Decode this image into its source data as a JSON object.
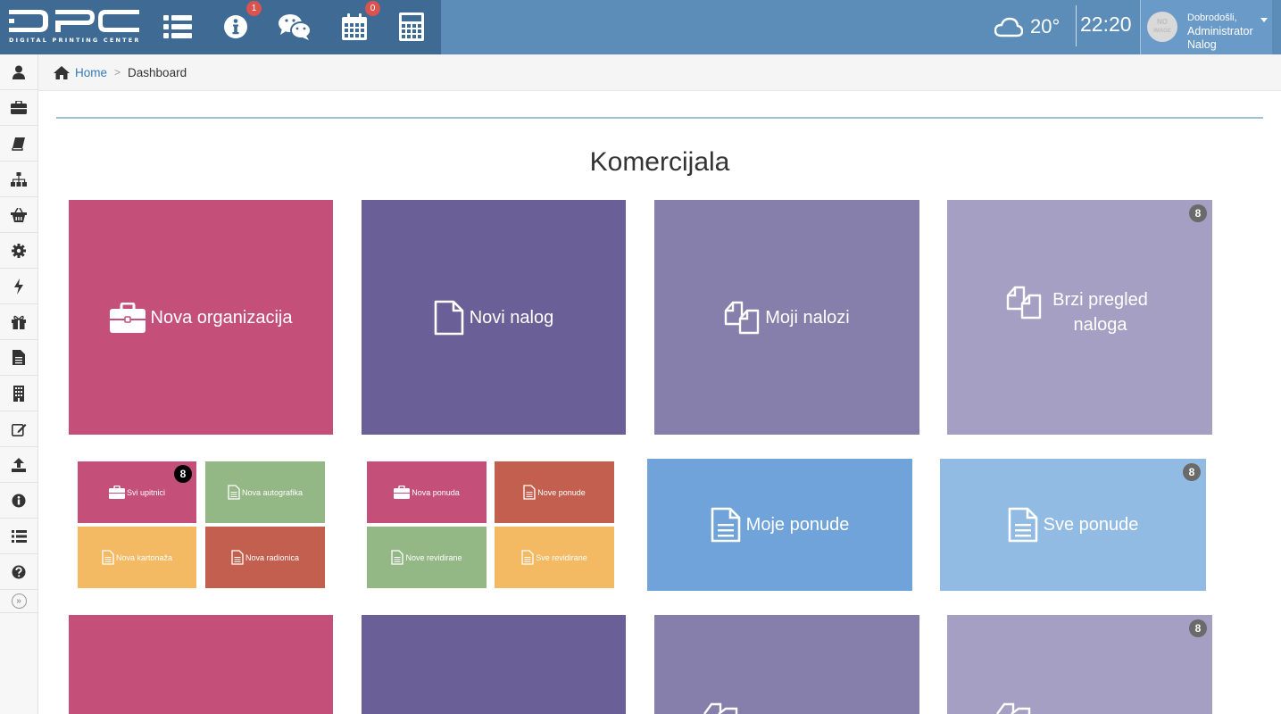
{
  "header": {
    "logo_text": "DPC",
    "logo_subtitle": "DIGITAL PRINTING CENTER",
    "icons": [
      {
        "name": "list-icon"
      },
      {
        "name": "info-icon",
        "badge": "1"
      },
      {
        "name": "chat-icon"
      },
      {
        "name": "calendar-icon",
        "badge": "0"
      },
      {
        "name": "calculator-icon"
      }
    ],
    "weather": {
      "icon": "cloud-icon",
      "temperature": "20°"
    },
    "clock": "22:20",
    "user": {
      "avatar_text": "NO IMAGE",
      "greeting": "Dobrodošli,",
      "name": "Administrator",
      "role": "Nalog"
    }
  },
  "sidebar": {
    "items": [
      {
        "icon": "user-icon"
      },
      {
        "icon": "briefcase-icon"
      },
      {
        "icon": "book-icon"
      },
      {
        "icon": "sitemap-icon"
      },
      {
        "icon": "basket-icon"
      },
      {
        "icon": "gear-icon"
      },
      {
        "icon": "bolt-icon"
      },
      {
        "icon": "gift-icon"
      },
      {
        "icon": "file-icon"
      },
      {
        "icon": "building-icon"
      },
      {
        "icon": "edit-icon"
      },
      {
        "icon": "upload-icon"
      },
      {
        "icon": "info-circle-icon"
      },
      {
        "icon": "list-icon"
      },
      {
        "icon": "question-icon"
      }
    ],
    "expand_label": "»"
  },
  "breadcrumb": {
    "home": "Home",
    "current": "Dashboard"
  },
  "section": {
    "title": "Komercijala"
  },
  "tiles_row1": [
    {
      "label": "Nova organizacija",
      "icon": "briefcase-icon",
      "color": "#c4507a"
    },
    {
      "label": "Novi nalog",
      "icon": "file-icon",
      "color": "#6a5f96"
    },
    {
      "label": "Moji nalozi",
      "icon": "copy-icon",
      "color": "#877fab"
    },
    {
      "label": "Brzi pregled naloga",
      "icon": "copy-icon",
      "color": "#a49fc3",
      "count": "8"
    }
  ],
  "mini_group1": [
    {
      "label": "Svi upitnici",
      "icon": "briefcase-icon",
      "color": "#c4507a",
      "count": "8"
    },
    {
      "label": "Nova autografika",
      "icon": "file-text-icon",
      "color": "#93b785"
    },
    {
      "label": "Nova kartonaža",
      "icon": "file-text-icon",
      "color": "#f4b963"
    },
    {
      "label": "Nova radionica",
      "icon": "file-text-icon",
      "color": "#c35f4e"
    }
  ],
  "mini_group2": [
    {
      "label": "Nova ponuda",
      "icon": "briefcase-icon",
      "color": "#c4507a"
    },
    {
      "label": "Nove ponude",
      "icon": "file-text-icon",
      "color": "#c35f4e"
    },
    {
      "label": "Nove revidirane",
      "icon": "file-text-icon",
      "color": "#93b785"
    },
    {
      "label": "Sve revidirane",
      "icon": "file-text-icon",
      "color": "#f4b963"
    }
  ],
  "tiles_row2": [
    {
      "label": "Moje ponude",
      "icon": "file-text-icon",
      "color": "#6fa3d9"
    },
    {
      "label": "Sve ponude",
      "icon": "file-text-icon",
      "color": "#92bbe4",
      "count": "8"
    }
  ],
  "tiles_row3": [
    {
      "color": "#c4507a"
    },
    {
      "color": "#6a5f96"
    },
    {
      "color": "#877fab"
    },
    {
      "color": "#a49fc3",
      "count": "8"
    }
  ]
}
